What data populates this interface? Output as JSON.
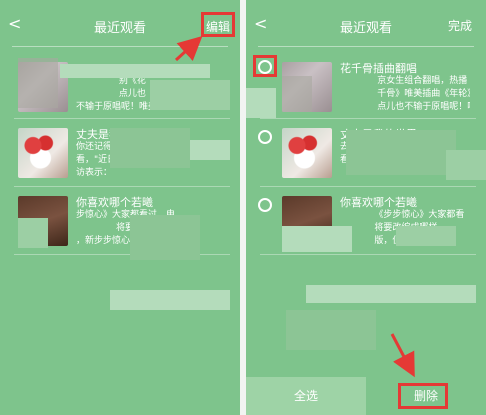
{
  "left": {
    "header": {
      "back_glyph": "<",
      "title": "最近观看",
      "edit_label": "编辑"
    },
    "items": [
      {
        "title": "",
        "desc": "               别《花\n               点儿也\n不输于原唱呢！唯美海                音，打..."
      },
      {
        "title": "丈夫是我的...",
        "desc": "你还记得\n看，\"近日，\n访表示："
      },
      {
        "title": "你喜欢哪个若曦",
        "desc": "步惊心》大家都看过，电\n              将要改编成哪样小说\n，新步步惊心》欢乐"
      }
    ]
  },
  "right": {
    "header": {
      "back_glyph": "<",
      "title": "最近观看",
      "done_label": "完成"
    },
    "items": [
      {
        "title": "花千骨插曲翻唱",
        "desc": "             京女生组合翻唱，热播\n             千骨》唯美插曲《年轮》\n             点儿也不输于原唱呢！唯美清..."
      },
      {
        "title": "丈夫是我的世界",
        "desc": "去\n看\n"
      },
      {
        "title": "你喜欢哪个若曦",
        "desc": "            《步步惊心》大家都看\n            将要改编成哪样\n            版，但电影《新..."
      }
    ],
    "bottom": {
      "select_all_label": "全选",
      "delete_label": "删除"
    }
  },
  "colors": {
    "panel_bg": "#7ec48c",
    "highlight": "#e53935"
  }
}
